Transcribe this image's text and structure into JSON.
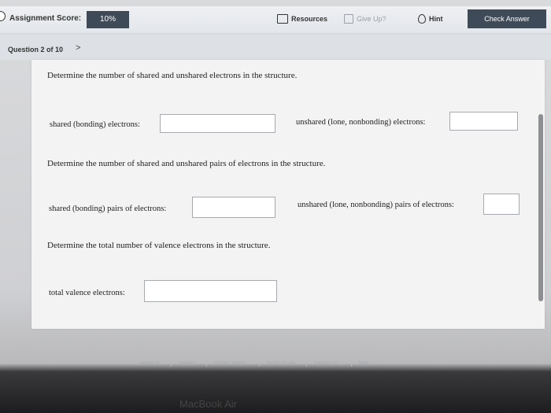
{
  "header": {
    "score_label": "Assignment Score:",
    "score_value": "10%",
    "resources_label": "Resources",
    "give_up_label": "Give Up?",
    "hint_label": "Hint",
    "check_answer_label": "Check Answer"
  },
  "question_nav": {
    "label": "Question 2 of 10",
    "next_symbol": ">"
  },
  "question": {
    "prompt1": "Determine the number of shared and unshared electrons in the structure.",
    "shared_electrons_label": "shared (bonding) electrons:",
    "shared_electrons_value": "",
    "unshared_electrons_label": "unshared (lone, nonbonding) electrons:",
    "unshared_electrons_value": "",
    "prompt2": "Determine the number of shared and unshared pairs of electrons in the structure.",
    "shared_pairs_label": "shared (bonding) pairs of electrons:",
    "shared_pairs_value": "",
    "unshared_pairs_label": "unshared (lone, nonbonding) pairs of electrons:",
    "unshared_pairs_value": "",
    "prompt3": "Determine the total number of valence electrons in the structure.",
    "total_valence_label": "total valence electrons:",
    "total_valence_value": ""
  },
  "footer": {
    "links": [
      "about us",
      "careers",
      "privacy policy",
      "terms of use",
      "contact us",
      "help"
    ]
  },
  "device_label": "MacBook Air"
}
